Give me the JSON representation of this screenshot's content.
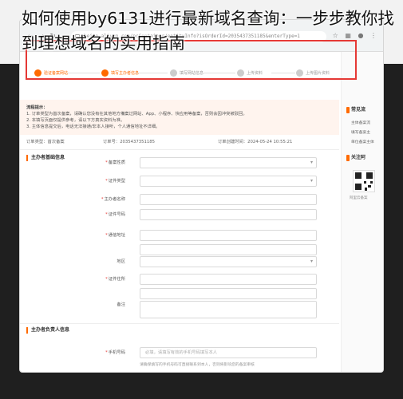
{
  "article_title": "如何使用by6131进行最新域名查询：一步步教你找到理想域名的实用指南",
  "browser": {
    "url": "beian.aliyun.com/pcContainer/entityInfo?isOrderId=2035437351185&enterType=1",
    "icons": [
      "star-icon",
      "extensions-icon",
      "profile-icon",
      "menu-icon"
    ]
  },
  "steps": [
    {
      "label": "验证备案网站",
      "active": true
    },
    {
      "label": "填写主办者信息",
      "active": true
    },
    {
      "label": "填写网站信息",
      "active": false
    },
    {
      "label": "上传资料",
      "active": false
    },
    {
      "label": "上传图片资料",
      "active": false
    }
  ],
  "notice": {
    "title": "流程提示：",
    "lines": [
      "1. 订单类型为首次备案，请确认您没有在其他地方備案过网站、App、小程序、快应用等备案，否则会因冲突被驳回。",
      "2. 本填写页面仅提供参考，请以下方真实资料为准。",
      "3. 主体信息提交后，电话无法接通/非本人接听，个人通信地址不详细。"
    ]
  },
  "order": {
    "type_label": "订单类型：首次备案",
    "number_label": "订单号：2035437351185",
    "created_label": "订单创建时间：2024-05-24 10:55:21"
  },
  "section_sponsor": "主办者基础信息",
  "form": {
    "filing_province": {
      "label": "备案性质",
      "value": ""
    },
    "cert_type": {
      "label": "证件类型",
      "value": ""
    },
    "sponsor_nature": {
      "label": "主办者名称",
      "value": ""
    },
    "cert_number": {
      "label": "证件号码",
      "value": ""
    },
    "address": {
      "label": "通信地址",
      "value": ""
    },
    "region": {
      "label": "地区",
      "value": ""
    },
    "cert_address": {
      "label": "证件住所",
      "value": ""
    },
    "remark": {
      "label": "备注",
      "value": ""
    }
  },
  "section_contact": "主办者负责人信息",
  "contact": {
    "phone_label": "手机号码",
    "phone_placeholder": "必填，请填写有效的手机号码填写本人",
    "phone_hint": "请确保填写的手机号码可直接联系到本人，否则将影响您的备案审核"
  },
  "sidebar": {
    "faq_title": "常见流",
    "faq_links": [
      "主体备案流",
      "填写备案主",
      "单位备案主体"
    ],
    "follow_title": "关注阿",
    "qr_caption": "阿里云备案"
  },
  "colors": {
    "accent": "#ff6a00",
    "highlight_box": "#e53935",
    "notice_bg": "#fff4ee"
  }
}
